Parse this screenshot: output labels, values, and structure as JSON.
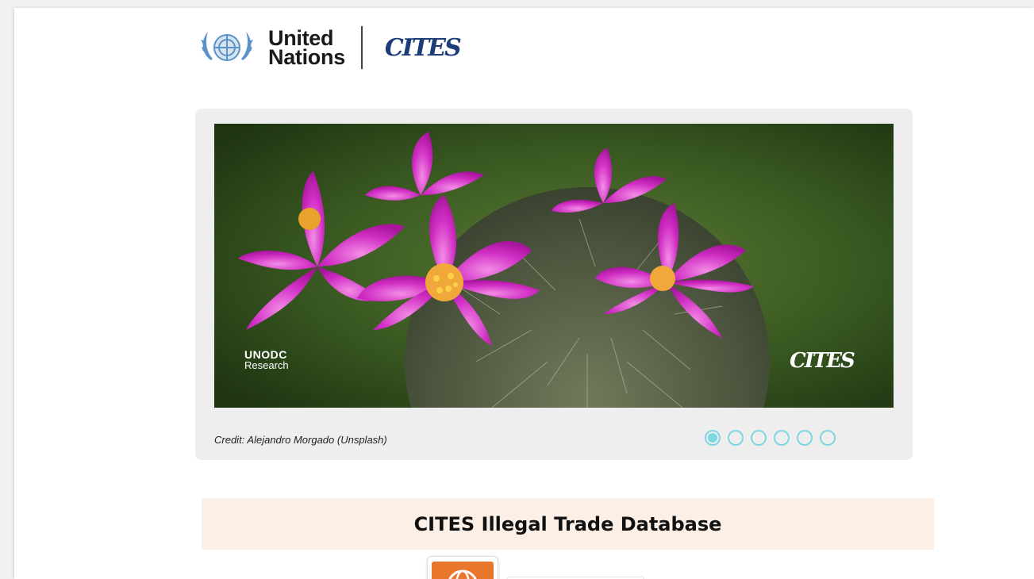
{
  "header": {
    "un_line1": "United",
    "un_line2": "Nations",
    "cites_logo": "CITES",
    "un_emblem_icon": "un-emblem-icon"
  },
  "carousel": {
    "slide_logo_left_line1": "UNODC",
    "slide_logo_left_line2": "Research",
    "slide_logo_right": "CITES",
    "credit": "Credit: Alejandro Morgado (Unsplash)",
    "dot_count": 6,
    "active_dot": 0,
    "accent_color": "#7fd6e2"
  },
  "banner": {
    "title": "CITES Illegal Trade Database",
    "background": "#fbefe6"
  },
  "bottom": {
    "icon": "globe-icon",
    "icon_color": "#e8762c"
  }
}
